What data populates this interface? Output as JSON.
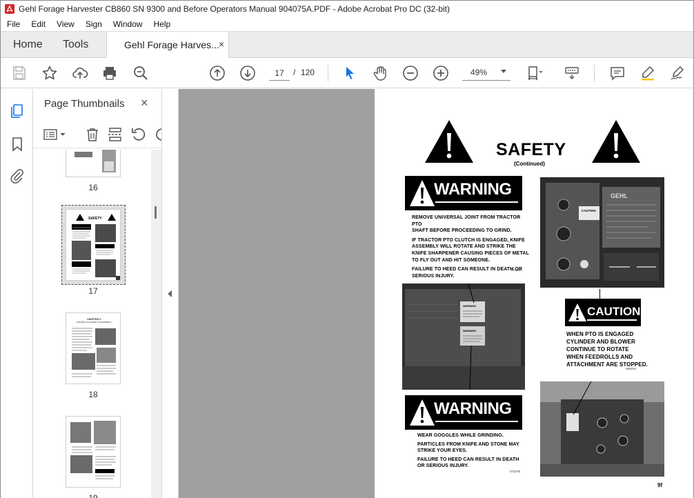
{
  "window": {
    "title": "Gehl Forage Harvester CB860 SN 9300 and Before Operators Manual 904075A.PDF - Adobe Acrobat Pro DC (32-bit)"
  },
  "menu": [
    "File",
    "Edit",
    "View",
    "Sign",
    "Window",
    "Help"
  ],
  "tabs": {
    "home": "Home",
    "tools": "Tools",
    "document": "Gehl Forage Harves...",
    "close_symbol": "×"
  },
  "toolbar": {
    "current_page": "17",
    "separator": "/",
    "total_pages": "120",
    "zoom": "49%"
  },
  "thumbnails_panel": {
    "title": "Page Thumbnails",
    "close_symbol": "×",
    "pages": [
      {
        "label": "16"
      },
      {
        "label": "17",
        "selected": true
      },
      {
        "label": "18"
      },
      {
        "label": "19"
      }
    ],
    "thumb17_title": "SAFETY",
    "thumb18_title": "CHAPTER 3",
    "thumb18_subtitle": "CONTROLS & SAFETY EQUIPMENT"
  },
  "page": {
    "title": "SAFETY",
    "subtitle": "(Continued)",
    "warning1": {
      "label": "WARNING",
      "lines": [
        "REMOVE UNIVERSAL JOINT FROM TRACTOR PTO",
        "SHAFT BEFORE PROCEEDING TO GRIND."
      ],
      "lines2": [
        "IF TRACTOR PTO CLUTCH IS ENGAGED, KNIFE",
        "ASSEMBLY WILL ROTATE AND STRIKE THE",
        "KNIFE SHARPENER CAUSING PIECES OF METAL",
        "TO FLY OUT AND HIT SOMEONE."
      ],
      "lines3": [
        "FAILURE TO HEED CAN RESULT IN DEATH OR",
        "SERIOUS INJURY."
      ],
      "code": "073257"
    },
    "caution": {
      "label": "CAUTION",
      "lines": [
        "WHEN PTO IS ENGAGED",
        "CYLINDER AND BLOWER",
        "CONTINUE TO ROTATE",
        "WHEN FEEDROLLS AND",
        "ATTACHMENT ARE STOPPED."
      ],
      "code": "069234"
    },
    "warning2": {
      "label": "WARNING",
      "line1": "WEAR GOGGLES WHILE GRINDING.",
      "lines2": [
        "PARTICLES FROM KNIFE AND STONE MAY",
        "STRIKE YOUR EYES."
      ],
      "lines3": [
        "FAILURE TO HEED CAN RESULT IN DEATH",
        "OR SERIOUS INJURY."
      ],
      "code": "073276"
    },
    "photo_labels": {
      "brand": "GEHL",
      "caution_small": "CAUTION",
      "warning_small": "WARNING"
    },
    "page_number": "9f"
  },
  "colors": {
    "accent_blue": "#1473e6",
    "acrobat_red": "#d7262a",
    "doc_bg": "#a0a0a0"
  }
}
